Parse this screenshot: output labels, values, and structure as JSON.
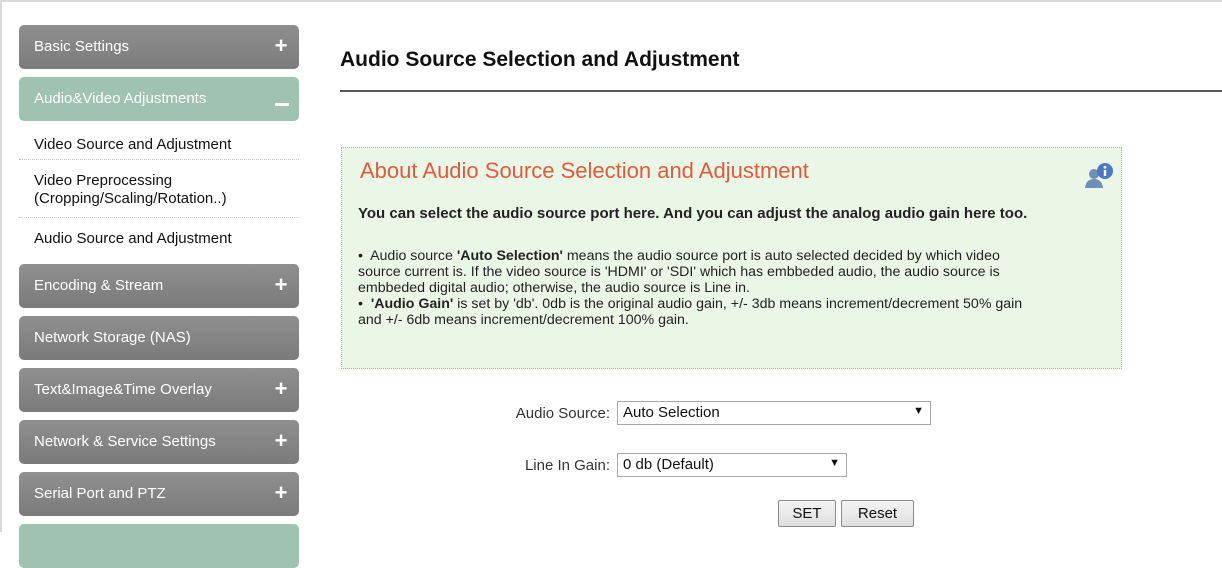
{
  "sidebar": {
    "items": [
      {
        "label": "Basic Settings",
        "expand": "+"
      },
      {
        "label": "Audio&Video Adjustments",
        "expand": "–"
      },
      {
        "label": "Encoding & Stream",
        "expand": "+"
      },
      {
        "label": "Network Storage (NAS)",
        "expand": ""
      },
      {
        "label": "Text&Image&Time Overlay",
        "expand": "+"
      },
      {
        "label": "Network & Service Settings",
        "expand": "+"
      },
      {
        "label": "Serial Port and PTZ",
        "expand": "+"
      }
    ],
    "sub_items": [
      {
        "label": "Video Source and Adjustment"
      },
      {
        "label_line1": "Video Preprocessing",
        "label_line2": "(Cropping/Scaling/Rotation..)"
      },
      {
        "label": "Audio Source and Adjustment"
      }
    ]
  },
  "main": {
    "title": "Audio Source Selection and Adjustment",
    "info": {
      "title": "About Audio Source Selection and Adjustment",
      "subtitle": "You can select the audio source port here. And you can adjust the analog audio gain here too.",
      "p1_bold": "'Auto Selection'",
      "p1_pre": "Audio source ",
      "p1_line1_post": " means the audio source port is auto selected decided by which video",
      "p1_line2": "source current is. If the video source is 'HDMI' or 'SDI' which has embbeded audio, the audio source is",
      "p1_line3": "embbeded digital audio; otherwise, the audio source is Line in.",
      "p2_bold": "'Audio Gain'",
      "p2_line1_post": " is set by 'db'. 0db is the original audio gain, +/- 3db means increment/decrement 50% gain",
      "p2_line2": "and +/- 6db means increment/decrement 100% gain.",
      "bullet": "•"
    },
    "form": {
      "audio_source_label": "Audio Source:",
      "audio_source_value": "Auto Selection",
      "line_in_gain_label": "Line In Gain:",
      "line_in_gain_value": "0 db (Default)",
      "dropdown_arrow": "▼",
      "set_label": "SET",
      "reset_label": "Reset"
    }
  },
  "colors": {
    "menu_gray": "#858585",
    "menu_active": "#9fc3b0",
    "info_bg": "#ebf7e6",
    "info_title": "#e05a3c"
  }
}
